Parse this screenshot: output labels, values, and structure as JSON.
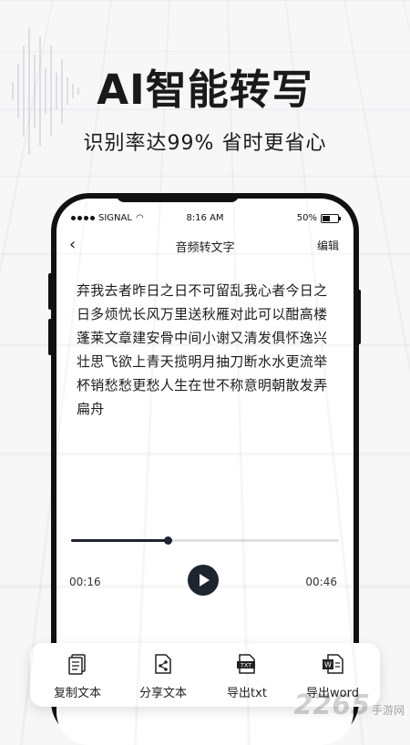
{
  "hero": {
    "title": "AI智能转写",
    "subtitle": "识别率达99%  省时更省心"
  },
  "status_bar": {
    "carrier": "SIGNAL",
    "time": "8:16 AM",
    "battery": "50%",
    "battery_level": 0.5
  },
  "navbar": {
    "back_icon": "chevron-left",
    "title": "音频转文字",
    "edit_label": "编辑"
  },
  "transcript": {
    "text": "弃我去者昨日之日不可留乱我心者今日之日多烦忧长风万里送秋雁对此可以酣高楼蓬莱文章建安骨中间小谢又清发俱怀逸兴壮思飞欲上青天揽明月抽刀断水水更流举杯销愁愁更愁人生在世不称意明朝散发弄扁舟"
  },
  "player": {
    "current_time": "00:16",
    "total_time": "00:46",
    "progress": 0.36,
    "play_icon": "play-icon"
  },
  "toolbar": {
    "items": [
      {
        "label": "复制文本",
        "icon": "document-copy-icon"
      },
      {
        "label": "分享文本",
        "icon": "share-file-icon"
      },
      {
        "label": "导出txt",
        "icon": "txt-file-icon"
      },
      {
        "label": "导出word",
        "icon": "word-file-icon"
      }
    ]
  },
  "watermark": {
    "logo": "2265",
    "suffix": "手游网"
  },
  "colors": {
    "accent_dark": "#1e2430",
    "background": "#f7f7f8"
  }
}
